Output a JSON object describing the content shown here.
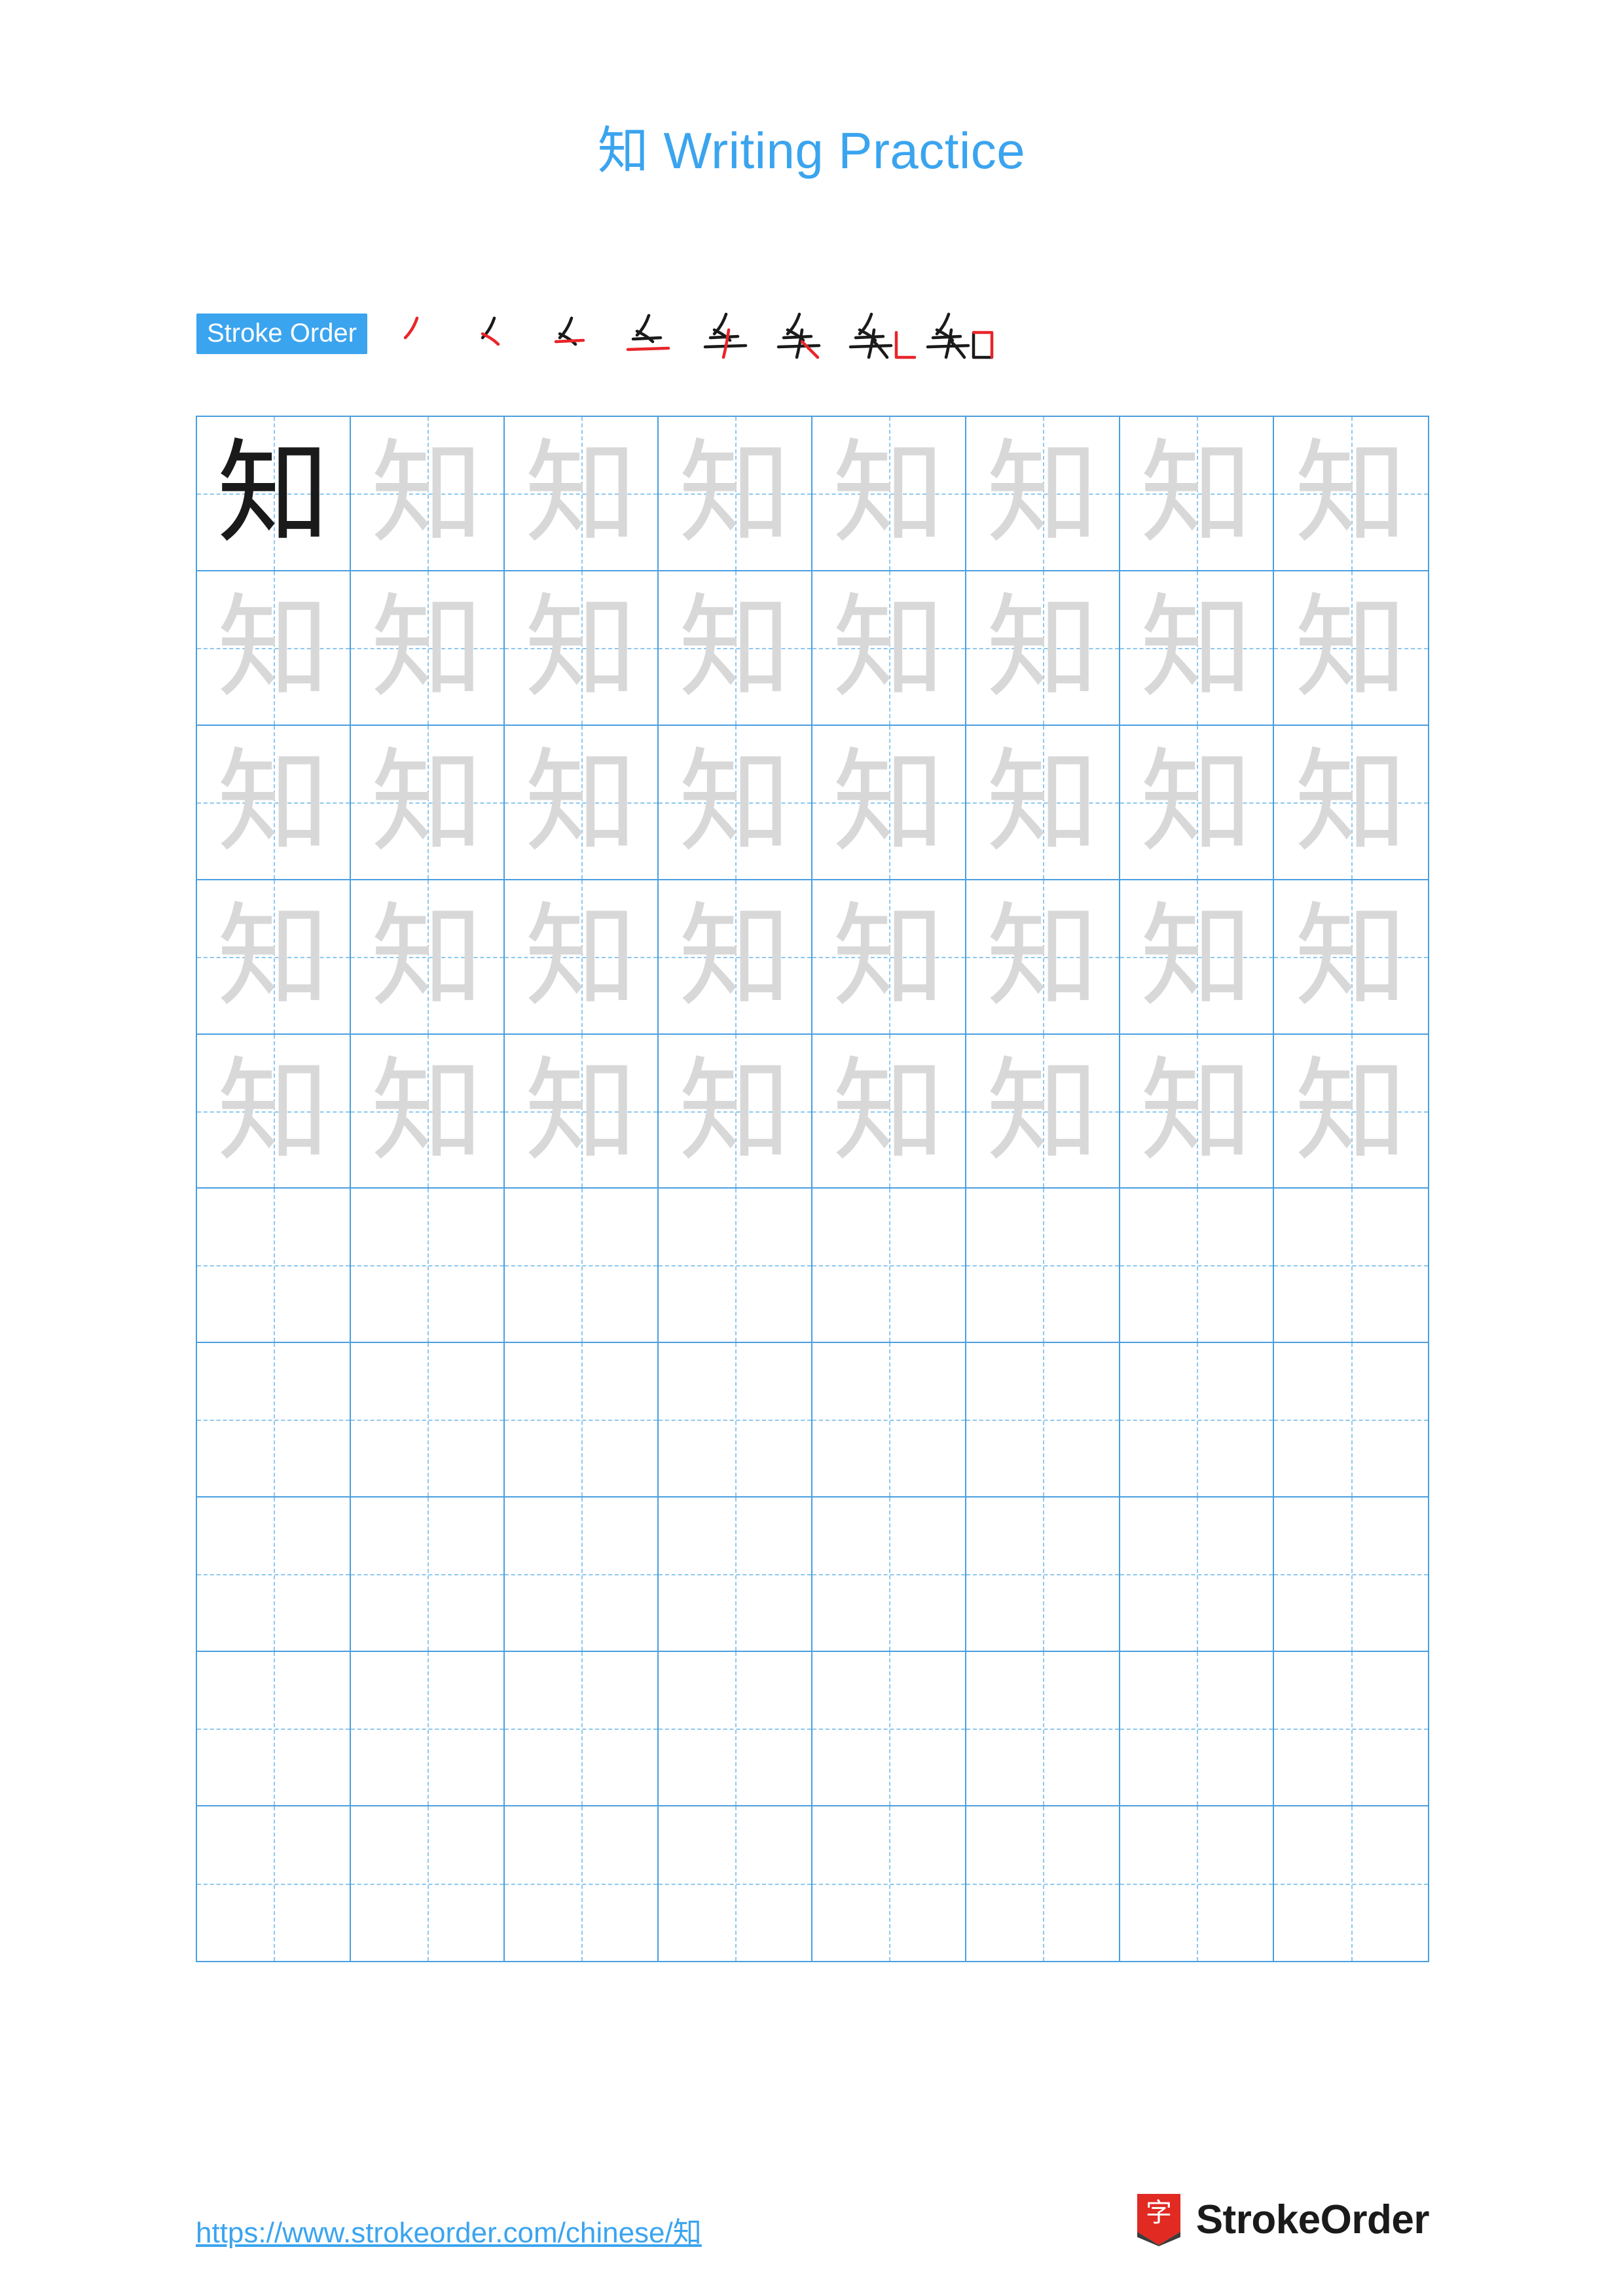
{
  "document": {
    "title": "知 Writing Practice",
    "character": "知",
    "title_color": "#3ba4ef"
  },
  "stroke_order": {
    "badge_label": "Stroke Order",
    "badge_bg": "#3ba4ef",
    "new_stroke_color": "#e8252a",
    "existing_stroke_color": "#1a1a1a",
    "steps": [
      {
        "index": 1,
        "partial": "丿"
      },
      {
        "index": 2,
        "partial": "𠂉"
      },
      {
        "index": 3,
        "partial": "⺅"
      },
      {
        "index": 4,
        "partial": "矢"
      },
      {
        "index": 5,
        "partial": "矢"
      },
      {
        "index": 6,
        "partial": "矢"
      },
      {
        "index": 7,
        "partial": "知"
      },
      {
        "index": 8,
        "partial": "知"
      }
    ]
  },
  "grid": {
    "columns": 8,
    "rows": 10,
    "border_color": "#4a9fe0",
    "guide_color": "#8ec8ef",
    "solid_glyph_color": "#1a1a1a",
    "ghost_glyph_color": "#d8d8d8",
    "solid_cells": 1,
    "ghost_cells": 39,
    "empty_cells": 40,
    "character": "知"
  },
  "footer": {
    "url": "https://www.strokeorder.com/chinese/知",
    "brand_name": "StrokeOrder",
    "brand_mark_char": "字",
    "brand_mark_color": "#e02a22"
  }
}
